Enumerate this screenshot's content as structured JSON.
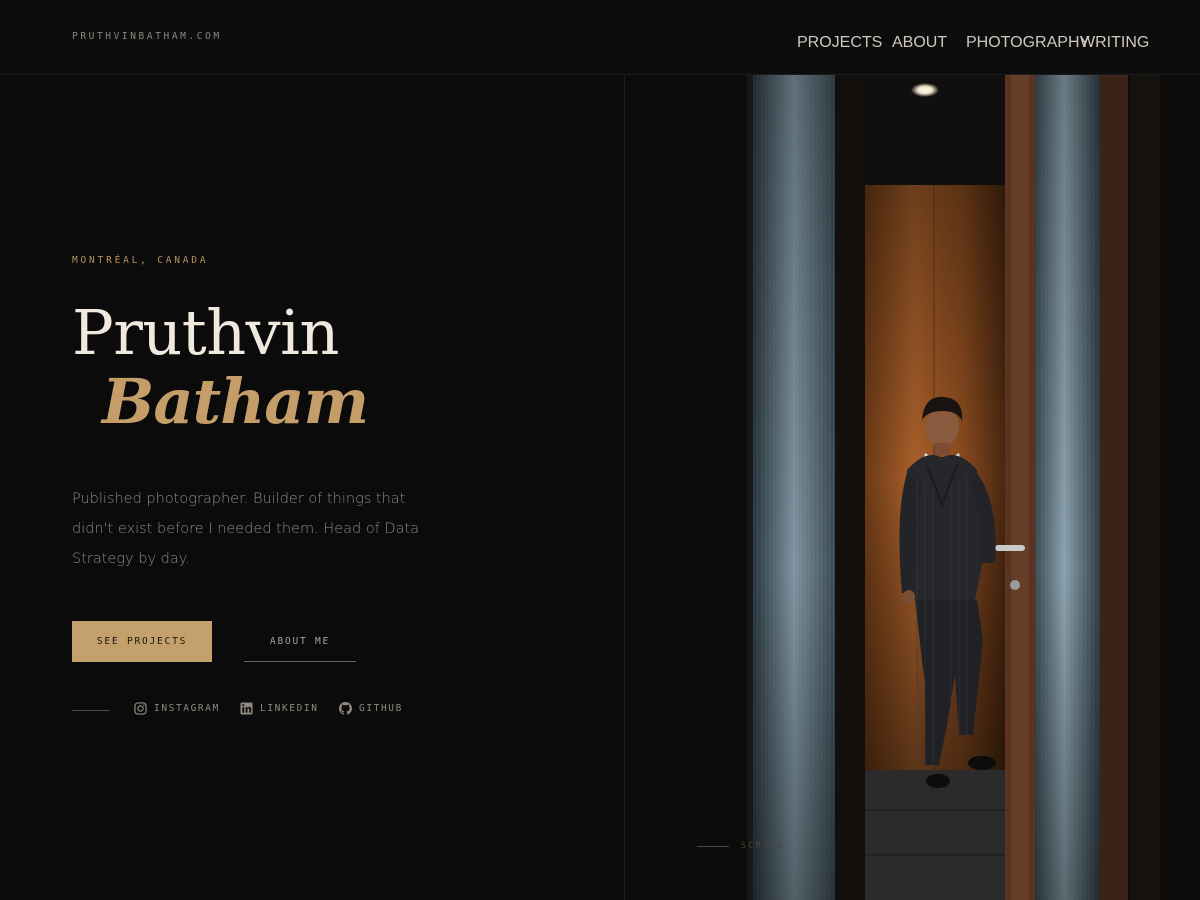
{
  "header": {
    "site_name": "PRUTHVINBATHAM.COM",
    "nav": [
      "PROJECTS",
      "ABOUT",
      "PHOTOGRAPHY",
      "WRITING"
    ]
  },
  "hero": {
    "location": "MONTRÉAL, CANADA",
    "name_first": "Pruthvin",
    "name_last": "Batham",
    "bio": "Published photographer. Builder of things that didn't exist before I needed them. Head of Data Strategy by day.",
    "primary_button": "SEE PROJECTS",
    "secondary_button": "ABOUT ME"
  },
  "social": [
    {
      "label": "INSTAGRAM",
      "icon": "instagram-icon"
    },
    {
      "label": "LINKEDIN",
      "icon": "linkedin-icon"
    },
    {
      "label": "GITHUB",
      "icon": "github-icon"
    }
  ],
  "scroll_label": "SCROLL",
  "colors": {
    "background": "#0b0b0b",
    "accent_gold": "#c4a06c",
    "text_light": "#efe9de",
    "text_muted": "#8e887e"
  }
}
